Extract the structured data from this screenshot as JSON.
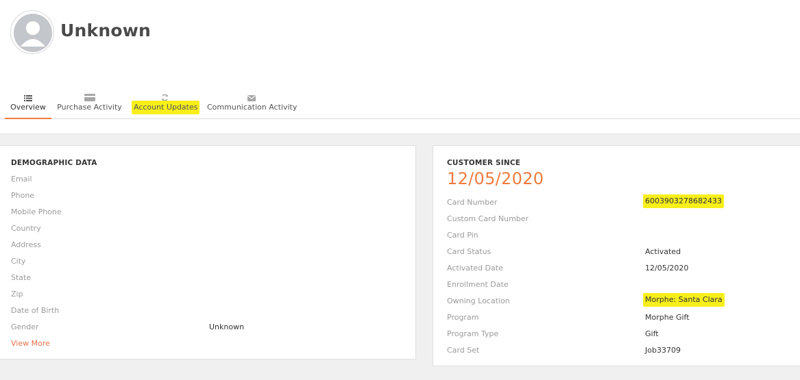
{
  "profile": {
    "name": "Unknown"
  },
  "tabs": [
    {
      "label": "Overview",
      "icon": "list-icon"
    },
    {
      "label": "Purchase Activity",
      "icon": "credit-card-icon"
    },
    {
      "label": "Account Updates",
      "icon": "refresh-icon"
    },
    {
      "label": "Communication Activity",
      "icon": "envelope-icon"
    }
  ],
  "demographic": {
    "title": "DEMOGRAPHIC DATA",
    "fields": [
      {
        "label": "Email",
        "value": ""
      },
      {
        "label": "Phone",
        "value": ""
      },
      {
        "label": "Mobile Phone",
        "value": ""
      },
      {
        "label": "Country",
        "value": ""
      },
      {
        "label": "Address",
        "value": ""
      },
      {
        "label": "City",
        "value": ""
      },
      {
        "label": "State",
        "value": ""
      },
      {
        "label": "Zip",
        "value": ""
      },
      {
        "label": "Date of Birth",
        "value": ""
      },
      {
        "label": "Gender",
        "value": "Unknown"
      }
    ],
    "view_more": "View More"
  },
  "customer": {
    "title": "CUSTOMER SINCE",
    "since_date": "12/05/2020",
    "fields": [
      {
        "label": "Card Number",
        "value": "6003903278682433"
      },
      {
        "label": "Custom Card Number",
        "value": ""
      },
      {
        "label": "Card Pin",
        "value": ""
      },
      {
        "label": "Card Status",
        "value": "Activated"
      },
      {
        "label": "Activated Date",
        "value": "12/05/2020"
      },
      {
        "label": "Enrollment Date",
        "value": ""
      },
      {
        "label": "Owning Location",
        "value": "Morphe: Santa Clara"
      },
      {
        "label": "Program",
        "value": "Morphe Gift"
      },
      {
        "label": "Program Type",
        "value": "Gift"
      },
      {
        "label": "Card Set",
        "value": "Job33709"
      }
    ]
  },
  "colors": {
    "accent": "#f07b3f",
    "highlight": "#f7ef1a"
  }
}
